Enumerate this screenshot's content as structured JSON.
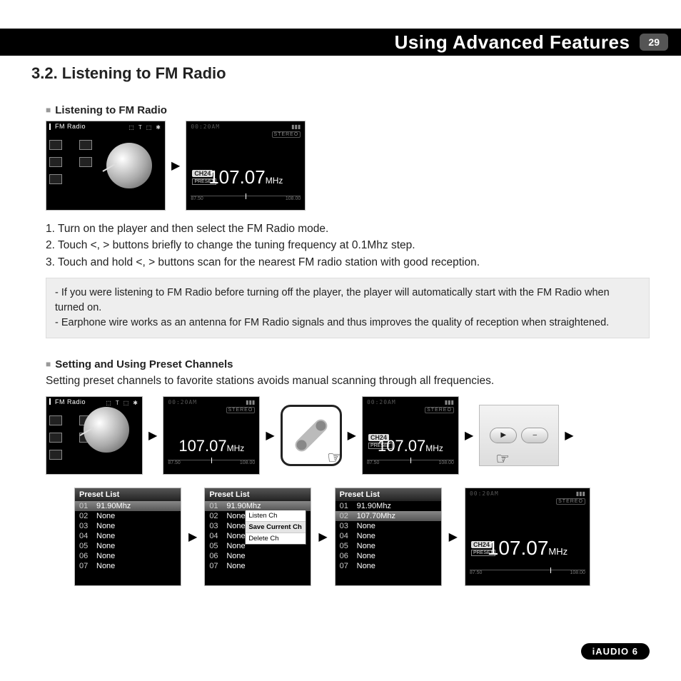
{
  "header": {
    "title": "Using Advanced Features",
    "page_number": "29"
  },
  "section": {
    "number_title": "3.2. Listening to FM Radio"
  },
  "sub1": {
    "heading": "Listening to FM Radio",
    "menu_label": "FM Radio",
    "tuner": {
      "time": "00:20AM",
      "stereo": "STEREO",
      "channel": "CH24",
      "preset": "PRESET",
      "frequency": "107.07",
      "unit": "MHz",
      "scale_low": "87.50",
      "scale_high": "108.00"
    },
    "steps": [
      "1. Turn on the player and then select the FM Radio mode.",
      "2. Touch <, > buttons briefly to change the tuning frequency at 0.1Mhz step.",
      "3. Touch and hold <, > buttons scan for the nearest FM radio station with good reception."
    ],
    "notes": [
      "-  If you were listening to FM Radio before turning off the player, the player will automatically start with the FM Radio when turned on.",
      "- Earphone wire works as an antenna for FM Radio signals and thus improves the quality of reception when straightened."
    ]
  },
  "sub2": {
    "heading": "Setting and Using Preset Channels",
    "description": "Setting preset channels to favorite stations avoids manual scanning through all frequencies.",
    "menu_label": "FM Radio",
    "tuner_nopreset": {
      "time": "00:20AM",
      "stereo": "STEREO",
      "frequency": "107.07",
      "unit": "MHz",
      "scale_low": "87.50",
      "scale_high": "108.00"
    },
    "tuner_preset": {
      "time": "00:20AM",
      "stereo": "STEREO",
      "channel": "CH24",
      "preset": "PRESET",
      "frequency": "107.07",
      "unit": "MHz",
      "scale_low": "87.50",
      "scale_high": "108.00"
    },
    "play_labels": {
      "play": "▶",
      "minus": "–"
    },
    "preset_header": "Preset List",
    "presets_a": [
      {
        "n": "01",
        "v": "91.90Mhz"
      },
      {
        "n": "02",
        "v": "None"
      },
      {
        "n": "03",
        "v": "None"
      },
      {
        "n": "04",
        "v": "None"
      },
      {
        "n": "05",
        "v": "None"
      },
      {
        "n": "06",
        "v": "None"
      },
      {
        "n": "07",
        "v": "None"
      }
    ],
    "popup": {
      "listen": "Listen Ch",
      "save": "Save Current Ch",
      "delete": "Delete Ch"
    },
    "presets_c": [
      {
        "n": "01",
        "v": "91.90Mhz"
      },
      {
        "n": "02",
        "v": "107.70Mhz"
      },
      {
        "n": "03",
        "v": "None"
      },
      {
        "n": "04",
        "v": "None"
      },
      {
        "n": "05",
        "v": "None"
      },
      {
        "n": "06",
        "v": "None"
      },
      {
        "n": "07",
        "v": "None"
      }
    ],
    "final_tuner": {
      "time": "00:20AM",
      "stereo": "STEREO",
      "channel": "CH24",
      "preset": "PRESET",
      "frequency": "107.07",
      "unit": "MHz",
      "scale_low": "87.50",
      "scale_high": "108.00"
    }
  },
  "footer": {
    "product": "iAUDIO 6"
  }
}
